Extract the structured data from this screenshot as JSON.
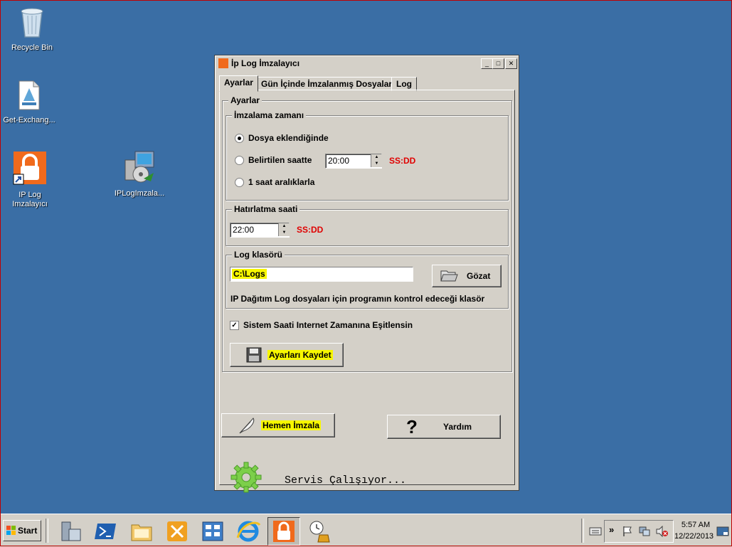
{
  "desktop": {
    "icons": [
      {
        "label": "Recycle Bin"
      },
      {
        "label": "Get-Exchang..."
      },
      {
        "label": "IP Log\nImzalayıcı"
      },
      {
        "label": "IPLogImzala..."
      }
    ]
  },
  "window": {
    "title": "İp Log İmzalayıcı",
    "controls": {
      "minimize": "_",
      "maximize": "□",
      "close": "✕"
    },
    "tabs": [
      "Ayarlar",
      "Gün İçinde İmzalanmış Dosyalar",
      "Log"
    ],
    "active_tab": "Ayarlar",
    "settings_group_title": "Ayarlar",
    "signing_time": {
      "title": "İmzalama zamanı",
      "options": [
        "Dosya eklendiğinde",
        "Belirtilen saatte",
        "1 saat aralıklarla"
      ],
      "selected": "Dosya eklendiğinde",
      "time_value": "20:00",
      "format_hint": "SS:DD"
    },
    "reminder": {
      "title": "Hatırlatma saati",
      "time_value": "22:00",
      "format_hint": "SS:DD"
    },
    "log_folder": {
      "title": "Log klasörü",
      "path": "C:\\Logs",
      "browse_label": "Gözat",
      "description": "IP Dağıtım Log dosyaları için programın kontrol edeceği klasör"
    },
    "sync_checkbox": {
      "label": "Sistem Saati Internet Zamanına Eşitlensin",
      "checked": true
    },
    "save_button": "Ayarları Kaydet",
    "sign_now_button": "Hemen İmzala",
    "help_button": "Yardım",
    "help_glyph": "?",
    "status_text": "Servis Çalışıyor..."
  },
  "taskbar": {
    "start_label": "Start",
    "time": "5:57 AM",
    "date": "12/22/2013",
    "chevron": "»"
  },
  "colors": {
    "desktop": "#3a6ea5",
    "window_face": "#d4d0c8",
    "highlight": "#f7f700",
    "format_hint": "#e00000",
    "app_orange": "#f06a1c",
    "gear_green": "#7ccf4a"
  }
}
